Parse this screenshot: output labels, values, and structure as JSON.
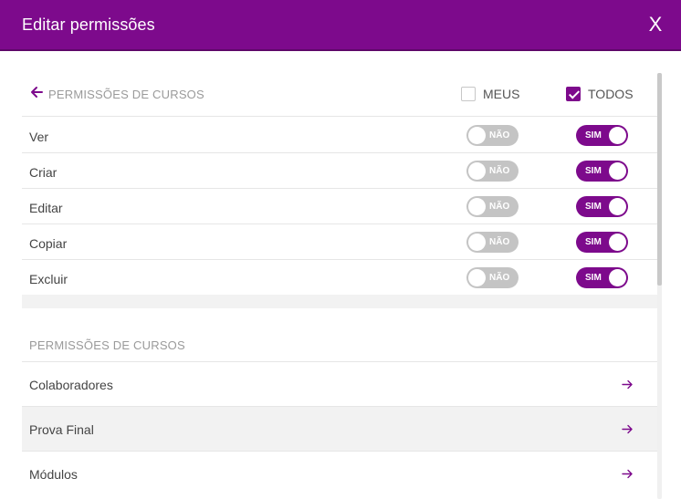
{
  "dialog": {
    "title": "Editar permissões",
    "close_label": "X"
  },
  "colors": {
    "accent": "#7d0a8c",
    "toggle_off": "#c4c4c4",
    "muted_text": "#9a9a9a",
    "row_highlight": "#f2f2f2"
  },
  "permissions": {
    "back_icon": "arrow-left-icon",
    "title": "PERMISSÕES DE CURSOS",
    "columns": {
      "meus": {
        "label": "MEUS",
        "checked": false
      },
      "todos": {
        "label": "TODOS",
        "checked": true
      }
    },
    "rows": [
      {
        "label": "Ver",
        "meus": "NÃO",
        "todos": "SIM"
      },
      {
        "label": "Criar",
        "meus": "NÃO",
        "todos": "SIM"
      },
      {
        "label": "Editar",
        "meus": "NÃO",
        "todos": "SIM"
      },
      {
        "label": "Copiar",
        "meus": "NÃO",
        "todos": "SIM"
      },
      {
        "label": "Excluir",
        "meus": "NÃO",
        "todos": "SIM"
      }
    ]
  },
  "sub_permissions": {
    "title": "PERMISSÕES DE CURSOS",
    "items": [
      {
        "label": "Colaboradores",
        "icon": "arrow-right-icon"
      },
      {
        "label": "Prova Final",
        "icon": "arrow-right-icon"
      },
      {
        "label": "Módulos",
        "icon": "arrow-right-icon"
      }
    ]
  }
}
